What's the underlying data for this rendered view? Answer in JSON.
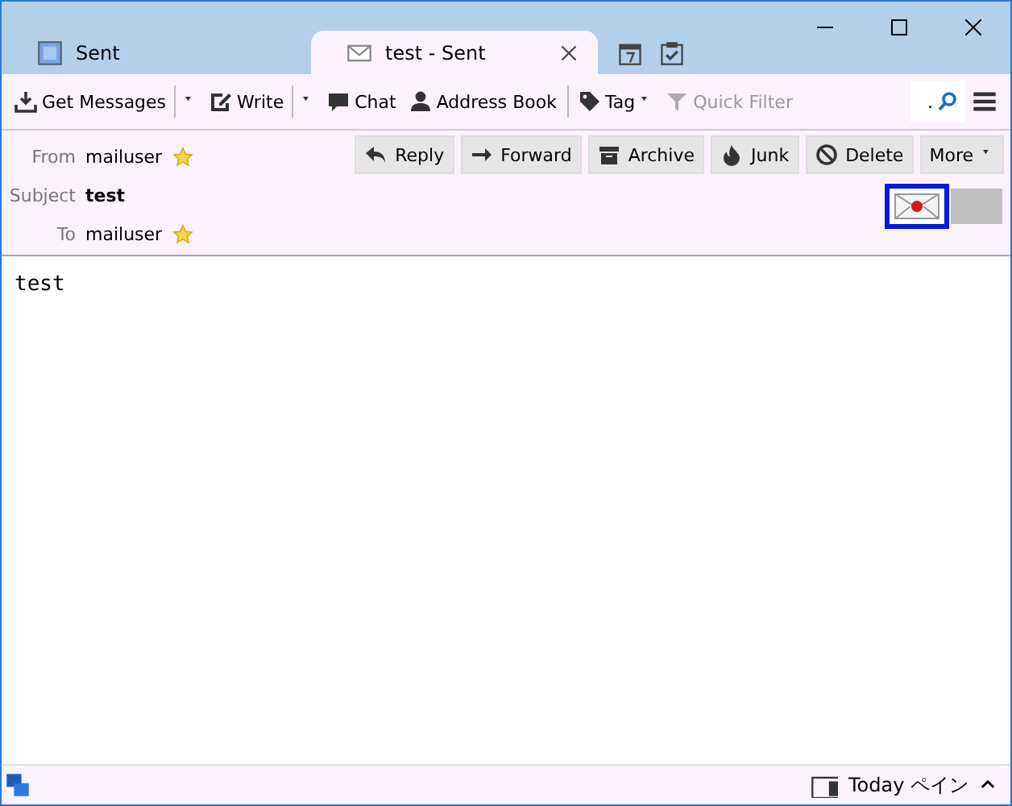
{
  "tabs": [
    {
      "label": "Sent",
      "selected": false,
      "kind": "folder"
    },
    {
      "label": "test - Sent",
      "selected": true,
      "kind": "message"
    }
  ],
  "toolbar": [
    {
      "label": "Get Messages",
      "kind": "download",
      "dropdown": true
    },
    {
      "label": "Write",
      "kind": "write",
      "dropdown": true
    },
    {
      "label": "Chat",
      "kind": "chat",
      "dropdown": false
    },
    {
      "label": "Address Book",
      "kind": "person",
      "dropdown": false
    },
    {
      "label": "Tag",
      "kind": "tag",
      "dropdown": false,
      "caret": true
    },
    {
      "label": "Quick Filter",
      "kind": "filter",
      "dropdown": false,
      "disabled": true
    }
  ],
  "search": {
    "value": "."
  },
  "header": [
    {
      "label": "From",
      "value": "mailuser",
      "starred": true,
      "bold": false
    },
    {
      "label": "Subject",
      "value": "test",
      "starred": false,
      "bold": true
    },
    {
      "label": "To",
      "value": "mailuser",
      "starred": true,
      "bold": false
    }
  ],
  "actions": [
    {
      "label": "Reply",
      "kind": "reply"
    },
    {
      "label": "Forward",
      "kind": "forward"
    },
    {
      "label": "Archive",
      "kind": "archive"
    },
    {
      "label": "Junk",
      "kind": "junk"
    },
    {
      "label": "Delete",
      "kind": "delete"
    },
    {
      "label": "More",
      "kind": "more"
    }
  ],
  "body": "test",
  "status": {
    "today_label": "Today ペイン"
  }
}
